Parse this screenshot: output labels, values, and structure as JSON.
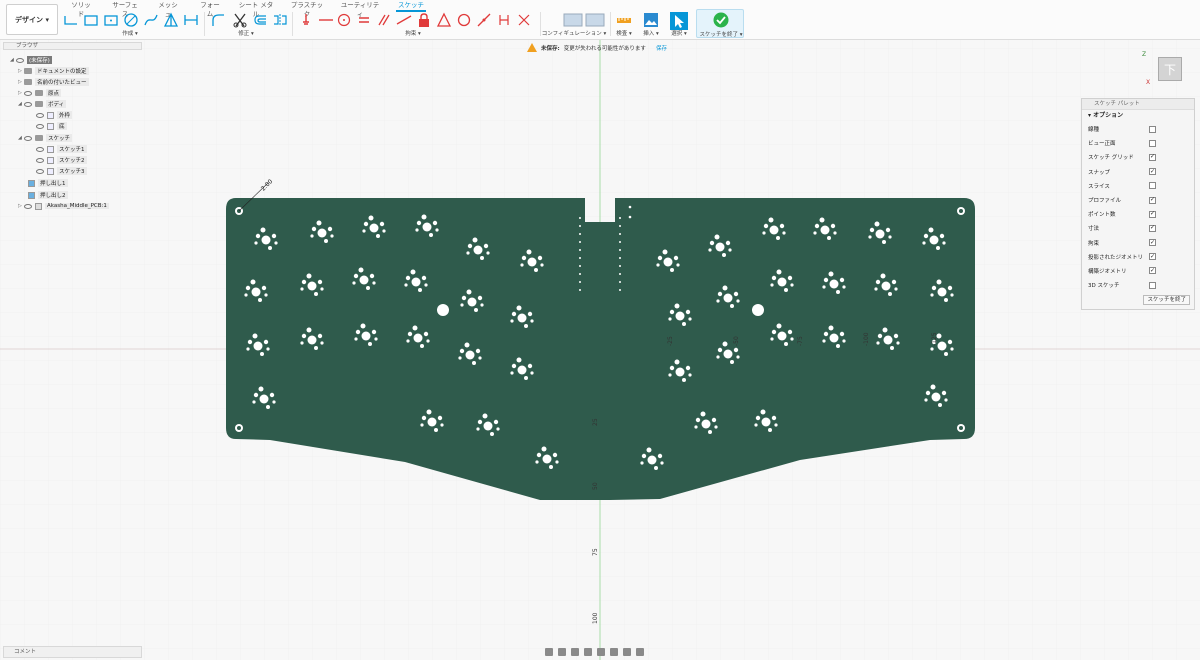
{
  "toolbar": {
    "workspace": "デザイン ▾",
    "tabs": [
      "ソリッド",
      "サーフェス",
      "メッシュ",
      "フォーム",
      "シート メタル",
      "プラスチック",
      "ユーティリティ",
      "スケッチ"
    ],
    "groups": {
      "create": "作成 ▾",
      "modify": "修正 ▾",
      "constraints": "拘束 ▾",
      "configure": "コンフィギュレーション ▾",
      "inspect": "検査 ▾",
      "insert": "挿入 ▾",
      "select": "選択 ▾",
      "finish": "スケッチを終了 ▾"
    },
    "active_color": "#0696d7",
    "finish_color": "#2bb34a"
  },
  "browser": {
    "title": "ブラウザ",
    "items": [
      {
        "label": "(未保存)"
      },
      {
        "label": "ドキュメントの設定"
      },
      {
        "label": "名前の付いたビュー"
      },
      {
        "label": "原点"
      },
      {
        "label": "ボディ"
      },
      {
        "label": "外枠"
      },
      {
        "label": "底"
      },
      {
        "label": "スケッチ"
      },
      {
        "label": "スケッチ1"
      },
      {
        "label": "スケッチ2"
      },
      {
        "label": "スケッチ3"
      },
      {
        "label": "押し出し1"
      },
      {
        "label": "押し出し2"
      },
      {
        "label": "Akasha_Middle_PCB:1"
      }
    ]
  },
  "comments": {
    "label": "コメント"
  },
  "warning": {
    "label": "未保存:",
    "message": "変更が失われる可能性があります",
    "save": "保存"
  },
  "palette": {
    "title": "スケッチ パレット",
    "section": "▾ オプション",
    "rows": [
      {
        "label": "線種",
        "checked": false
      },
      {
        "label": "ビュー正面",
        "checked": false
      },
      {
        "label": "スケッチ グリッド",
        "checked": true
      },
      {
        "label": "スナップ",
        "checked": true
      },
      {
        "label": "スライス",
        "checked": false
      },
      {
        "label": "プロファイル",
        "checked": true
      },
      {
        "label": "ポイント数",
        "checked": true
      },
      {
        "label": "寸法",
        "checked": true
      },
      {
        "label": "拘束",
        "checked": true
      },
      {
        "label": "投影されたジオメトリ",
        "checked": true
      },
      {
        "label": "構築ジオメトリ",
        "checked": true
      },
      {
        "label": "3D スケッチ",
        "checked": false
      }
    ],
    "finish": "スケッチを終了"
  },
  "viewcube": {
    "face": "下",
    "axis_z": "Z",
    "axis_x": "X"
  },
  "canvas": {
    "board_color": "#2f5b4c",
    "axis_labels": [
      "25",
      "50",
      "75",
      "100",
      "-25",
      "-50",
      "-75",
      "-100",
      "-125",
      "25",
      "50"
    ],
    "dim_label": "2.00"
  }
}
